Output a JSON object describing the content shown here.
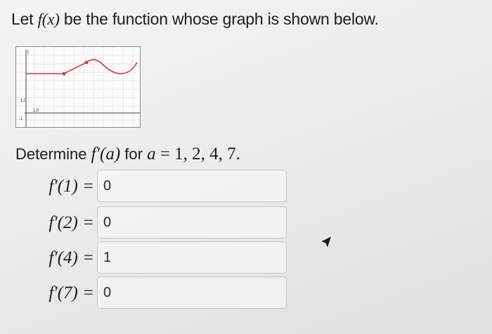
{
  "question": {
    "prefix": "Let ",
    "func": "f",
    "arg": "(x)",
    "suffix": " be the function whose graph is shown below."
  },
  "graph": {
    "tick_label_top": "1,0",
    "tick_label_mid": "1,0",
    "axis_label_y_top": "1",
    "axis_label_y_bottom": "-1",
    "curve_color": "#d63a3a"
  },
  "prompt": {
    "text": "Determine ",
    "expr": "f′(a)",
    "middle": " for ",
    "var": "a",
    "values": " = 1, 2, 4, 7."
  },
  "answers": [
    {
      "label": "f′(1) = ",
      "value": "0"
    },
    {
      "label": "f′(2) = ",
      "value": "0"
    },
    {
      "label": "f′(4) = ",
      "value": "1"
    },
    {
      "label": "f′(7) = ",
      "value": "0"
    }
  ],
  "cursor_icon": "mouse-pointer-icon"
}
